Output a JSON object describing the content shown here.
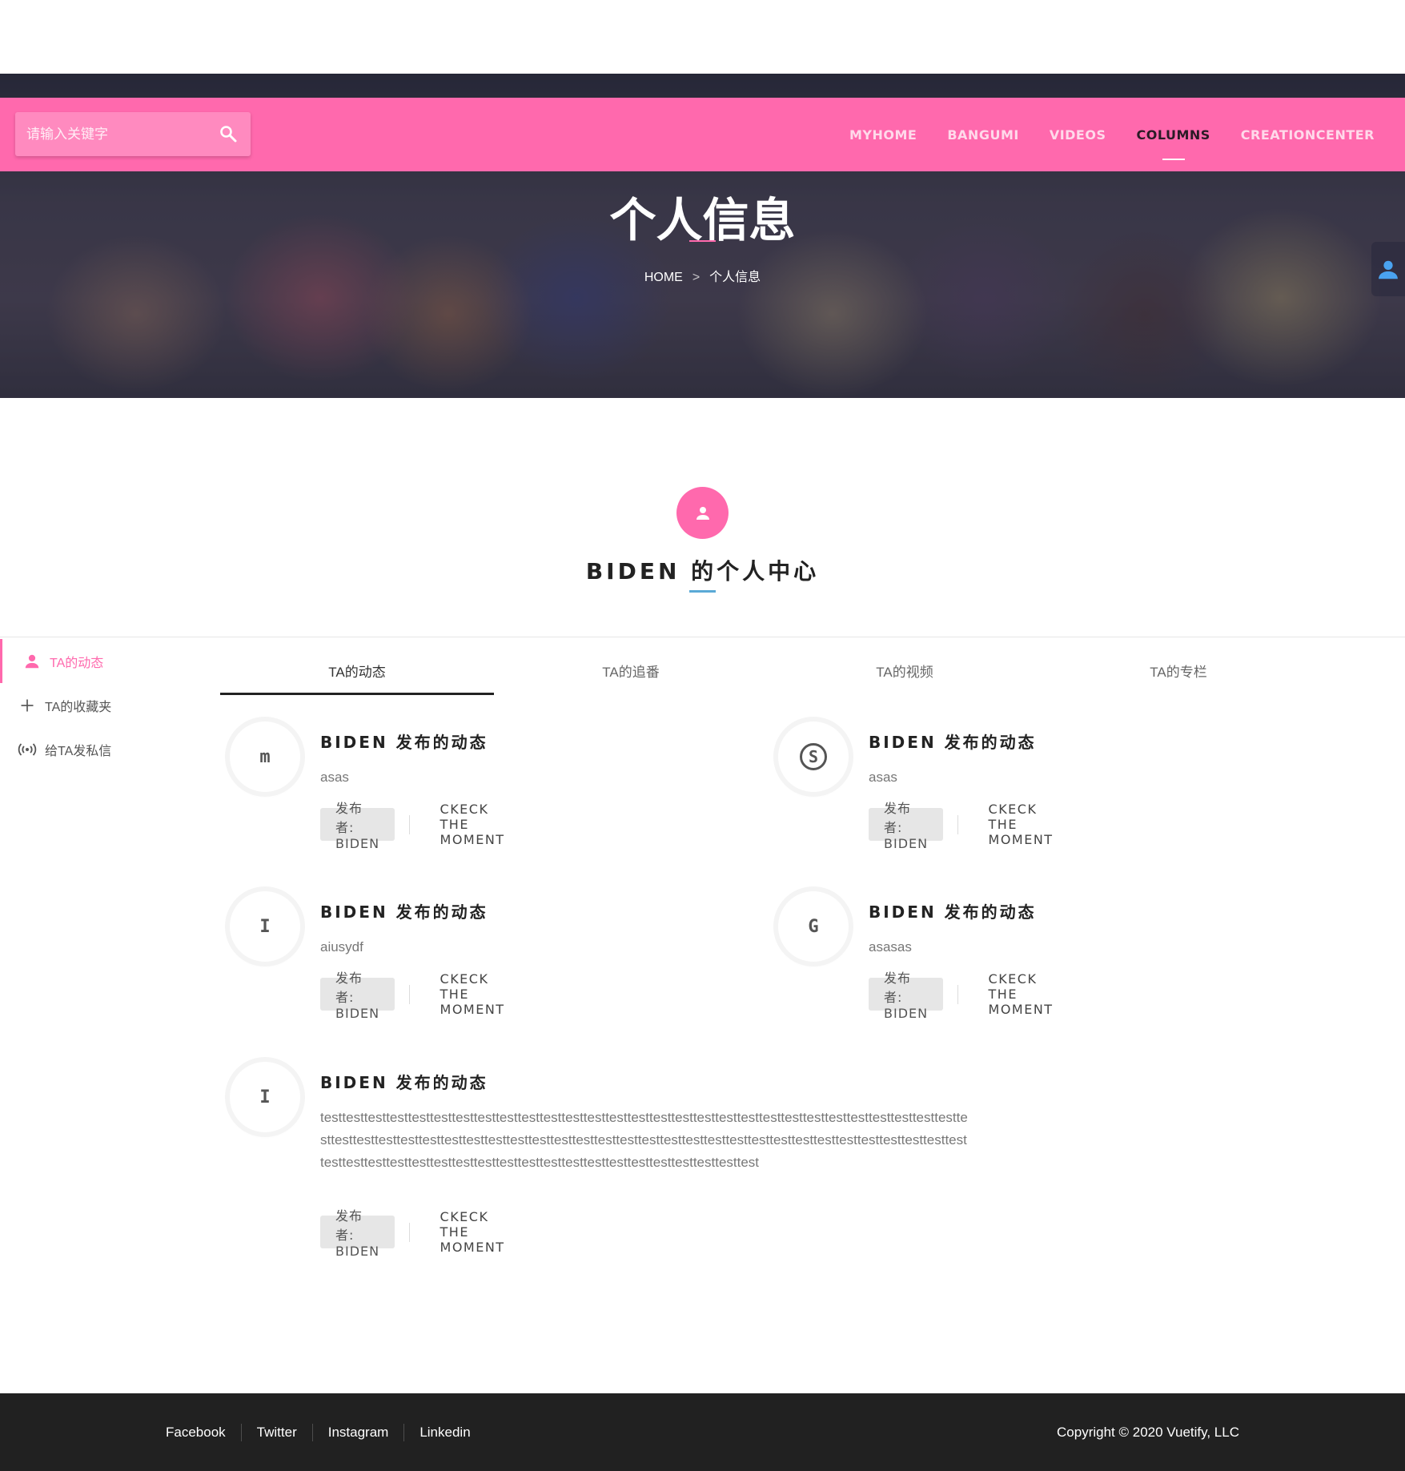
{
  "colors": {
    "accent_pink": "#ff69ad",
    "underline_blue": "#5aa9d6",
    "fab_icon_blue": "#4aa3f0",
    "footer_bg": "#212121"
  },
  "navbar": {
    "search": {
      "placeholder": "请输入关键字",
      "icon": "search-icon"
    },
    "links": [
      "MYHOME",
      "BANGUMI",
      "VIDEOS",
      "COLUMNS",
      "CREATIONCENTER"
    ],
    "active_link": "COLUMNS"
  },
  "hero": {
    "title": "个人信息",
    "breadcrumb": {
      "home": "HOME",
      "separator": ">",
      "current": "个人信息"
    },
    "user_button_icon": "user-icon"
  },
  "profile": {
    "avatar_icon": "user-icon",
    "title": "BIDEN 的个人中心"
  },
  "sidebar": {
    "items": [
      {
        "label": "TA的动态",
        "icon": "user-icon",
        "active": true
      },
      {
        "label": "TA的收藏夹",
        "icon": "plus-icon",
        "active": false
      },
      {
        "label": "给TA发私信",
        "icon": "broadcast-icon",
        "active": false
      }
    ]
  },
  "tabs": {
    "items": [
      "TA的动态",
      "TA的追番",
      "TA的视频",
      "TA的专栏"
    ],
    "active": "TA的动态"
  },
  "moments": [
    {
      "icon_glyph": "m",
      "title": "BIDEN 发布的动态",
      "content": "asas",
      "publisher": "发布者: BIDEN",
      "action": "CKECK THE MOMENT"
    },
    {
      "icon_glyph": "S",
      "title": "BIDEN 发布的动态",
      "content": "asas",
      "publisher": "发布者: BIDEN",
      "action": "CKECK THE MOMENT"
    },
    {
      "icon_glyph": "I",
      "title": "BIDEN 发布的动态",
      "content": "aiusydf",
      "publisher": "发布者: BIDEN",
      "action": "CKECK THE MOMENT"
    },
    {
      "icon_glyph": "G",
      "title": "BIDEN 发布的动态",
      "content": "asasas",
      "publisher": "发布者: BIDEN",
      "action": "CKECK THE MOMENT"
    },
    {
      "icon_glyph": "I",
      "title": "BIDEN 发布的动态",
      "content": "testtesttesttesttesttesttesttesttesttesttesttesttesttesttesttesttesttesttesttesttesttesttesttesttesttesttesttesttesttesttesttesttesttesttesttesttesttesttesttesttesttesttesttesttesttesttesttesttesttesttesttesttesttesttesttesttesttesttesttesttesttesttesttesttesttesttesttesttesttesttesttesttesttesttesttesttesttesttest",
      "publisher": "发布者: BIDEN",
      "action": "CKECK THE MOMENT"
    }
  ],
  "footer": {
    "links": [
      "Facebook",
      "Twitter",
      "Instagram",
      "Linkedin"
    ],
    "copyright": "Copyright © 2020 Vuetify, LLC"
  }
}
